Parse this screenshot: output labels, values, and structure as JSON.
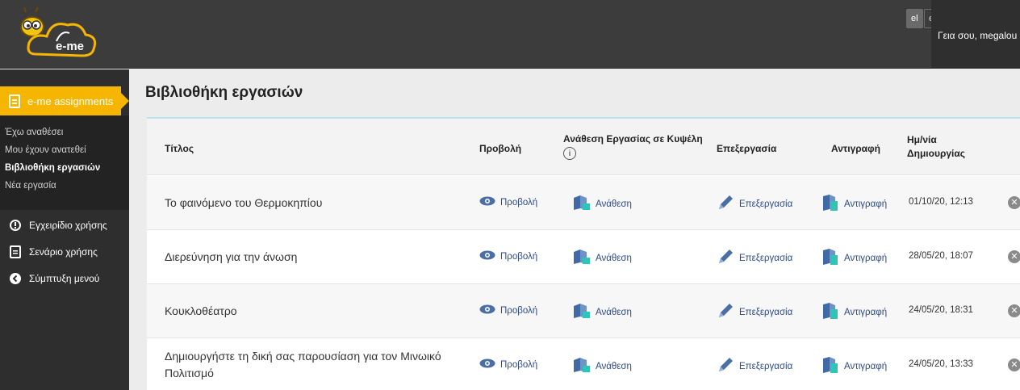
{
  "header": {
    "logo_text": "e-me",
    "languages": [
      "el",
      "en"
    ],
    "greeting": "Γεια σου, megalou"
  },
  "sidebar": {
    "active_app": "e-me assignments",
    "sub_items": [
      {
        "label": "Έχω αναθέσει"
      },
      {
        "label": "Μου έχουν ανατεθεί"
      },
      {
        "label": "Βιβλιοθήκη εργασιών"
      },
      {
        "label": "Νέα εργασία"
      }
    ],
    "links": [
      {
        "label": "Εγχειρίδιο χρήσης",
        "icon": "info-circle-icon"
      },
      {
        "label": "Σενάριο χρήσης",
        "icon": "document-icon"
      },
      {
        "label": "Σύμπτυξη μενού",
        "icon": "collapse-left-icon"
      }
    ]
  },
  "main": {
    "title": "Βιβλιοθήκη εργασιών",
    "columns": {
      "title": "Τίτλος",
      "view": "Προβολή",
      "assign": "Ανάθεση Εργασίας σε Κυψέλη",
      "assign_info": "i",
      "edit": "Επεξεργασία",
      "copy": "Αντιγραφή",
      "date_line1": "Ημ/νία",
      "date_line2": "Δημιουργίας"
    },
    "rows": [
      {
        "title": "Το φαινόμενο του Θερμοκηπίου",
        "view": "Προβολή",
        "assign": "Ανάθεση",
        "edit": "Επεξεργασία",
        "copy": "Αντιγραφή",
        "date": "01/10/20, 12:13"
      },
      {
        "title": "Διερεύνηση για την άνωση",
        "view": "Προβολή",
        "assign": "Ανάθεση",
        "edit": "Επεξεργασία",
        "copy": "Αντιγραφή",
        "date": "28/05/20, 18:07"
      },
      {
        "title": "Κουκλοθέατρο",
        "view": "Προβολή",
        "assign": "Ανάθεση",
        "edit": "Επεξεργασία",
        "copy": "Αντιγραφή",
        "date": "24/05/20, 18:31"
      },
      {
        "title": "Δημιουργήστε τη δική σας παρουσίαση για τον Μινωικό Πολιτισμό",
        "view": "Προβολή",
        "assign": "Ανάθεση",
        "edit": "Επεξεργασία",
        "copy": "Αντιγραφή",
        "date": "24/05/20, 13:33"
      }
    ]
  },
  "colors": {
    "topbar": "#3c3c3c",
    "sidebar": "#2e2e2e",
    "accent": "#f6b500",
    "link": "#2d4a86",
    "teal": "#2ec4b6"
  }
}
